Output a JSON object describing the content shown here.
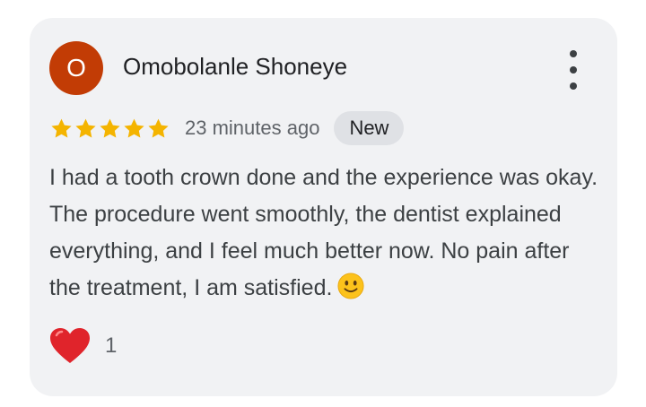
{
  "review": {
    "avatar_letter": "O",
    "reviewer_name": "Omobolanle Shoneye",
    "rating": 5,
    "max_rating": 5,
    "timestamp": "23 minutes ago",
    "badge": "New",
    "text": "I had a tooth crown done and the experience was okay. The procedure went smoothly, the dentist explained everything, and I feel much better now. No pain after the treatment, I am satisfied.",
    "trailing_emoji": "slightly-smiling-face-icon",
    "reaction_icon": "heart-icon",
    "reaction_count": "1"
  },
  "colors": {
    "card_background": "#f1f2f4",
    "avatar_background": "#c23c05",
    "star": "#f4b400",
    "badge_background": "#dfe1e5",
    "heart": "#e0242b"
  },
  "icons": {
    "menu": "more-vert-icon"
  }
}
